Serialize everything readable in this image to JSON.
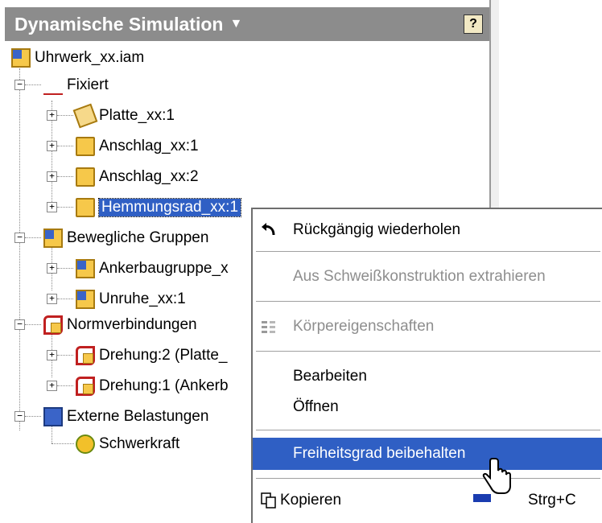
{
  "panel": {
    "title": "Dynamische Simulation",
    "title_arrow": "▼",
    "help": "?"
  },
  "tree": {
    "root": "Uhrwerk_xx.iam",
    "fixed": "Fixiert",
    "fixed_children": [
      "Platte_xx:1",
      "Anschlag_xx:1",
      "Anschlag_xx:2",
      "Hemmungsrad_xx:1"
    ],
    "moving": "Bewegliche Gruppen",
    "moving_children": [
      "Ankerbaugruppe_x",
      "Unruhe_xx:1"
    ],
    "joints": "Normverbindungen",
    "joint_children": [
      "Drehung:2 (Platte_",
      "Drehung:1 (Ankerb"
    ],
    "loads": "Externe Belastungen",
    "load_children": [
      "Schwerkraft"
    ]
  },
  "context_menu": {
    "undo": "Rückgängig wiederholen",
    "extract": "Aus Schweißkonstruktion extrahieren",
    "properties": "Körpereigenschaften",
    "edit": "Bearbeiten",
    "open": "Öffnen",
    "retain_dof": "Freiheitsgrad beibehalten",
    "copy": "Kopieren",
    "copy_shortcut": "Strg+C"
  },
  "colors": {
    "title_bg": "#8c8c8c",
    "selection": "#2f5fc4",
    "part_yellow": "#f6c84a",
    "constraint_red": "#c02020"
  }
}
